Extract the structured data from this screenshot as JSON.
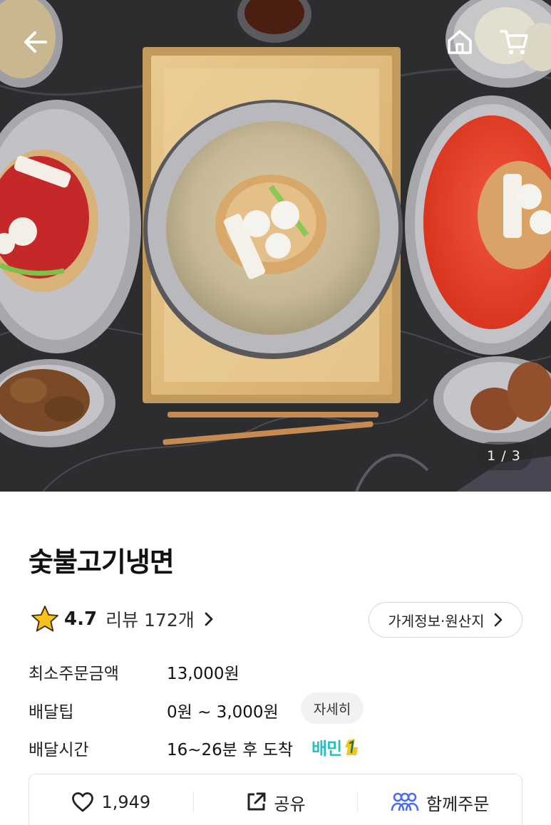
{
  "hero": {
    "page_indicator": "1 / 3",
    "back_icon": "arrow-left-icon",
    "home_icon": "home-icon",
    "cart_icon": "cart-icon"
  },
  "store": {
    "name": "숯불고기냉면",
    "rating": "4.7",
    "review_label": "리뷰 172개",
    "info_button": "가게정보·원산지"
  },
  "details": {
    "min_order_label": "최소주문금액",
    "min_order_value": "13,000원",
    "delivery_tip_label": "배달팁",
    "delivery_tip_value": "0원 ~ 3,000원",
    "delivery_tip_detail": "자세히",
    "delivery_time_label": "배달시간",
    "delivery_time_value": "16~26분 후 도착",
    "baemin_badge": "배민"
  },
  "actions": {
    "like_count": "1,949",
    "share_label": "공유",
    "group_order_label": "함께주문"
  },
  "colors": {
    "accent": "#2ac1bc",
    "badge_one": "#f5c518",
    "group_icon": "#4a6cf7",
    "star": "#f8c21c"
  }
}
